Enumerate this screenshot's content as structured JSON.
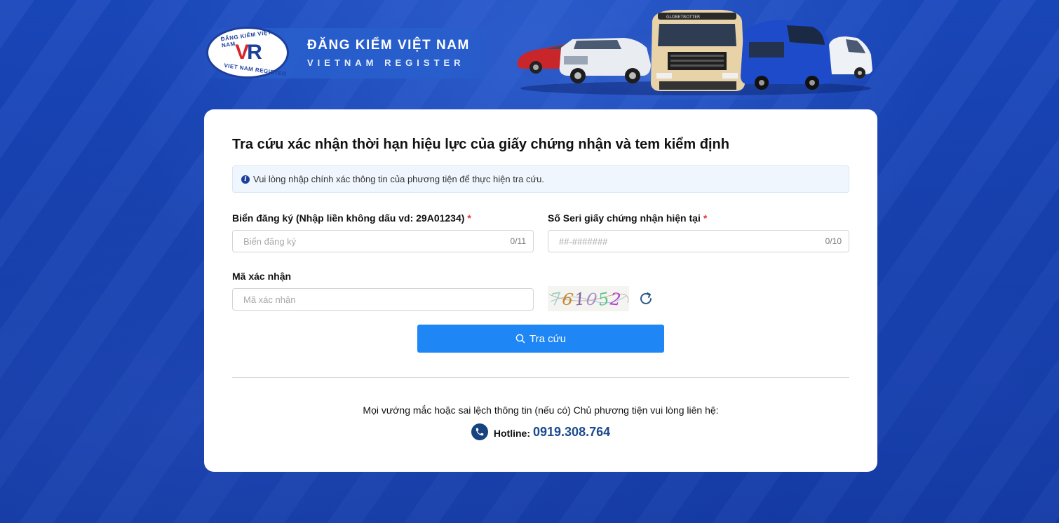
{
  "header": {
    "logo_ring_top": "ĐĂNG KIỂM VIỆT NAM",
    "logo_ring_bottom": "VIET NAM REGISTER",
    "logo_mark_v": "V",
    "logo_mark_r": "R",
    "brand_title": "ĐĂNG KIỂM VIỆT NAM",
    "brand_subtitle": "VIETNAM REGISTER",
    "truck_brand": "GLOBETROTTER"
  },
  "form": {
    "title": "Tra cứu xác nhận thời hạn hiệu lực của giấy chứng nhận và tem kiểm định",
    "notice": "Vui lòng nhập chính xác thông tin của phương tiện để thực hiện tra cứu.",
    "plate": {
      "label": "Biển đăng ký (Nhập liền không dấu vd: 29A01234)",
      "required_mark": "*",
      "placeholder": "Biển đăng ký",
      "value": "",
      "counter": "0/11"
    },
    "serial": {
      "label": "Số Seri giấy chứng nhận hiện tại",
      "required_mark": "*",
      "placeholder": "##-#######",
      "value": "",
      "counter": "0/10"
    },
    "captcha": {
      "label": "Mã xác nhận",
      "placeholder": "Mã xác nhận",
      "value": "",
      "digits": [
        "7",
        "6",
        "1",
        "0",
        "5",
        "2"
      ],
      "digit_colors": [
        "#9fd0c8",
        "#c8862f",
        "#8a5fa0",
        "#a88fc9",
        "#5fc487",
        "#b23fcf"
      ]
    },
    "search_label": "Tra cứu"
  },
  "contact": {
    "text": "Mọi vướng mắc hoặc sai lệch thông tin (nếu có) Chủ phương tiện vui lòng liên hệ:",
    "hotline_label": "Hotline:",
    "hotline_number": "0919.308.764"
  },
  "colors": {
    "background": "#1640b0",
    "primary_button": "#1e86f5",
    "hotline": "#1d4a8f",
    "required": "#e23b3b"
  }
}
